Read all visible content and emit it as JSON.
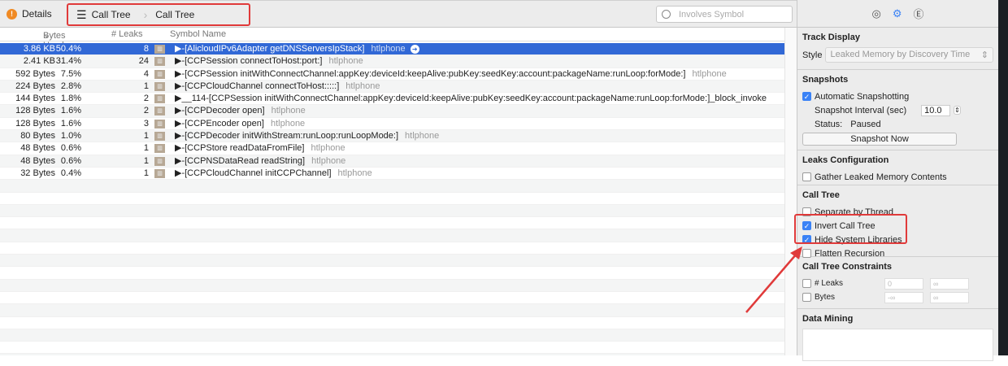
{
  "toolbar": {
    "details": "Details",
    "crumb1": "Call Tree",
    "crumb2": "Call Tree",
    "search_placeholder": "Involves Symbol"
  },
  "columns": {
    "bytes": "Bytes Used",
    "leaks": "# Leaks",
    "symbol": "Symbol Name"
  },
  "rows": [
    {
      "bytes": "3.86 KB",
      "pct": "50.4%",
      "leaks": "8",
      "symbol": "▶-[AlicloudIPv6Adapter getDNSServersIpStack]",
      "lib": "htlphone",
      "selected": true
    },
    {
      "bytes": "2.41 KB",
      "pct": "31.4%",
      "leaks": "24",
      "symbol": "▶-[CCPSession connectToHost:port:]",
      "lib": "htlphone"
    },
    {
      "bytes": "592 Bytes",
      "pct": "7.5%",
      "leaks": "4",
      "symbol": "▶-[CCPSession initWithConnectChannel:appKey:deviceId:keepAlive:pubKey:seedKey:account:packageName:runLoop:forMode:]",
      "lib": "htlphone"
    },
    {
      "bytes": "224 Bytes",
      "pct": "2.8%",
      "leaks": "1",
      "symbol": "▶-[CCPCloudChannel connectToHost:::::]",
      "lib": "htlphone"
    },
    {
      "bytes": "144 Bytes",
      "pct": "1.8%",
      "leaks": "2",
      "symbol": "▶__114-[CCPSession initWithConnectChannel:appKey:deviceId:keepAlive:pubKey:seedKey:account:packageName:runLoop:forMode:]_block_invoke",
      "lib": ""
    },
    {
      "bytes": "128 Bytes",
      "pct": "1.6%",
      "leaks": "2",
      "symbol": "▶-[CCPDecoder open]",
      "lib": "htlphone"
    },
    {
      "bytes": "128 Bytes",
      "pct": "1.6%",
      "leaks": "3",
      "symbol": "▶-[CCPEncoder open]",
      "lib": "htlphone"
    },
    {
      "bytes": "80 Bytes",
      "pct": "1.0%",
      "leaks": "1",
      "symbol": "▶-[CCPDecoder initWithStream:runLoop:runLoopMode:]",
      "lib": "htlphone"
    },
    {
      "bytes": "48 Bytes",
      "pct": "0.6%",
      "leaks": "1",
      "symbol": "▶-[CCPStore readDataFromFile]",
      "lib": "htlphone"
    },
    {
      "bytes": "48 Bytes",
      "pct": "0.6%",
      "leaks": "1",
      "symbol": "▶-[CCPNSDataRead readString]",
      "lib": "htlphone"
    },
    {
      "bytes": "32 Bytes",
      "pct": "0.4%",
      "leaks": "1",
      "symbol": "▶-[CCPCloudChannel initCCPChannel]",
      "lib": "htlphone"
    }
  ],
  "inspector": {
    "track_display": {
      "title": "Track Display",
      "style_label": "Style",
      "style_value": "Leaked Memory by Discovery Time"
    },
    "snapshots": {
      "title": "Snapshots",
      "auto": "Automatic Snapshotting",
      "interval_label": "Snapshot Interval (sec)",
      "interval": "10.0",
      "status_label": "Status:",
      "status": "Paused",
      "button": "Snapshot Now"
    },
    "leaks_config": {
      "title": "Leaks Configuration",
      "gather": "Gather Leaked Memory Contents"
    },
    "call_tree": {
      "title": "Call Tree",
      "separate": "Separate by Thread",
      "invert": "Invert Call Tree",
      "hide": "Hide System Libraries",
      "flatten": "Flatten Recursion"
    },
    "constraints": {
      "title": "Call Tree Constraints",
      "leaks": "# Leaks",
      "bytes": "Bytes",
      "leaks_min": "0",
      "leaks_max": "∞",
      "bytes_min": "-∞",
      "bytes_max": "∞"
    },
    "data_mining": {
      "title": "Data Mining"
    }
  },
  "colors": {
    "selection": "#3168d6",
    "highlight": "#e03a3a",
    "checkbox": "#3a82f6"
  }
}
